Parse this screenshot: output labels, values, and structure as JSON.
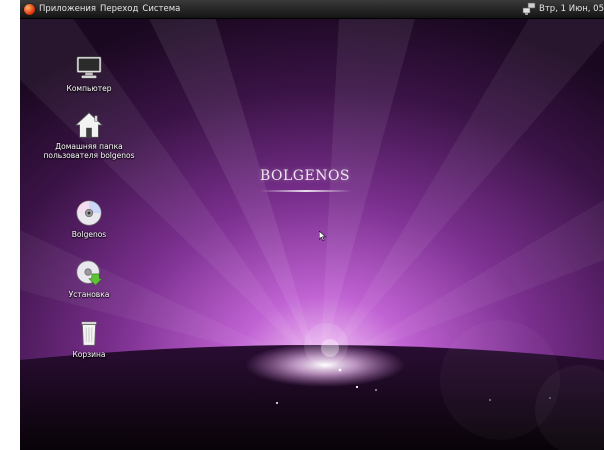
{
  "panel": {
    "menus": [
      "Приложения",
      "Переход",
      "Система"
    ],
    "clock": "Втр, 1 Июн, 05"
  },
  "desktop": {
    "brand_title": "BOLGENOS",
    "icons": [
      {
        "label": "Компьютер",
        "icon": "computer-icon"
      },
      {
        "label": "Домашняя папка пользователя bolgenos",
        "icon": "home-folder-icon"
      },
      {
        "label": "Bolgenos",
        "icon": "disc-icon"
      },
      {
        "label": "Установка",
        "icon": "installer-icon"
      },
      {
        "label": "Корзина",
        "icon": "trash-icon"
      }
    ]
  },
  "colors": {
    "wallpaper_glow": "#d98be6",
    "wallpaper_purple": "#6b2a7e",
    "wallpaper_dark": "#120716",
    "panel": "#262626",
    "text": "#ffffff"
  }
}
